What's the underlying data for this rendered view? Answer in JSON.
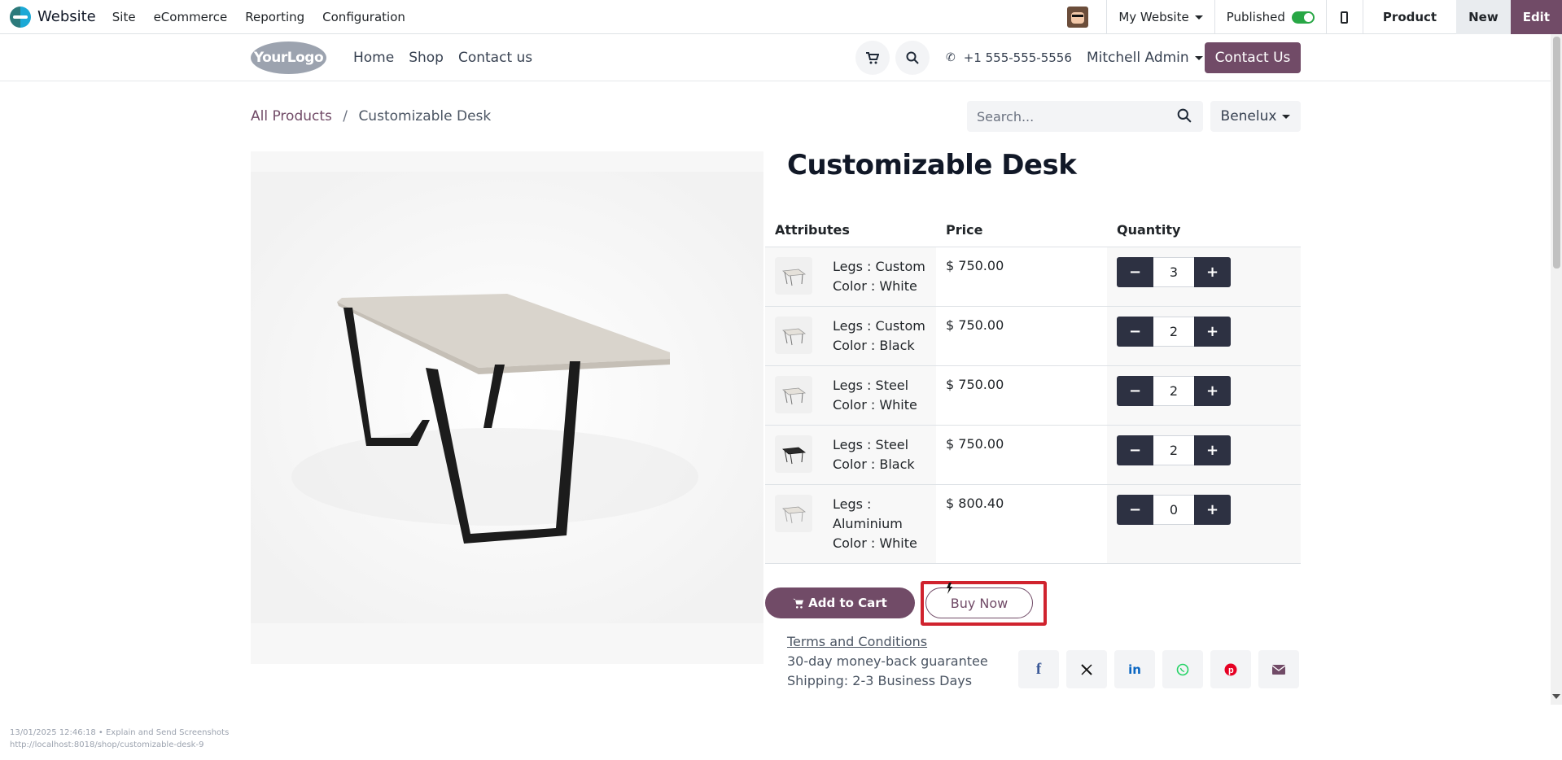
{
  "adminbar": {
    "app_name": "Website",
    "menu": [
      "Site",
      "eCommerce",
      "Reporting",
      "Configuration"
    ],
    "website_selector": "My Website",
    "published_label": "Published",
    "published": true,
    "tabs": {
      "product": "Product",
      "new": "New",
      "edit": "Edit"
    }
  },
  "header": {
    "logo_text": "YourLogo",
    "nav": [
      "Home",
      "Shop",
      "Contact us"
    ],
    "phone": "+1 555-555-5556",
    "user": "Mitchell Admin",
    "cta": "Contact Us"
  },
  "breadcrumb": {
    "parent": "All Products",
    "separator": "/",
    "current": "Customizable Desk"
  },
  "search": {
    "placeholder": "Search...",
    "value": ""
  },
  "pricelist": "Benelux",
  "product": {
    "title": "Customizable Desk",
    "table": {
      "headers": {
        "attributes": "Attributes",
        "price": "Price",
        "quantity": "Quantity"
      },
      "rows": [
        {
          "line1": "Legs : Custom",
          "line2": "Color : White",
          "line3": "",
          "price": "$ 750.00",
          "qty": "3"
        },
        {
          "line1": "Legs : Custom",
          "line2": "Color : Black",
          "line3": "",
          "price": "$ 750.00",
          "qty": "2"
        },
        {
          "line1": "Legs : Steel",
          "line2": "Color : White",
          "line3": "",
          "price": "$ 750.00",
          "qty": "2"
        },
        {
          "line1": "Legs : Steel",
          "line2": "Color : Black",
          "line3": "",
          "price": "$ 750.00",
          "qty": "2"
        },
        {
          "line1": "Legs :",
          "line2": "Aluminium",
          "line3": "Color : White",
          "price": "$ 800.40",
          "qty": "0"
        }
      ]
    },
    "add_to_cart": "Add to Cart",
    "buy_now": "Buy Now",
    "terms": "Terms and Conditions",
    "guarantee": "30-day money-back guarantee",
    "shipping": "Shipping: 2-3 Business Days"
  },
  "share_icons": [
    "facebook-icon",
    "x-icon",
    "linkedin-icon",
    "whatsapp-icon",
    "pinterest-icon",
    "email-icon"
  ],
  "colors": {
    "brand": "#714b67",
    "qty_button": "#2d3142",
    "highlight": "#d0232e"
  },
  "footer": {
    "caption": "13/01/2025 12:46:18 • Explain and Send Screenshots",
    "url": "http://localhost:8018/shop/customizable-desk-9"
  }
}
